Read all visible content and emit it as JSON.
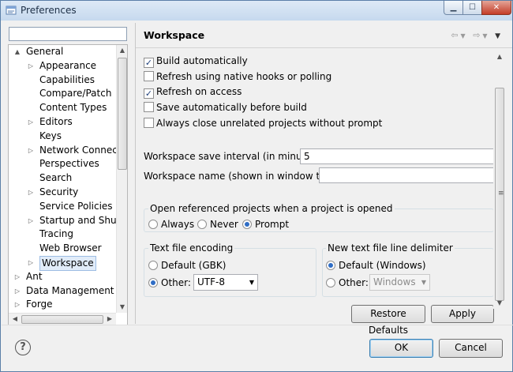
{
  "window": {
    "title": "Preferences"
  },
  "filter": {
    "value": ""
  },
  "tree": {
    "items": [
      {
        "label": "General",
        "level": 0,
        "arrow": "▲"
      },
      {
        "label": "Appearance",
        "level": 1,
        "arrow": "▷"
      },
      {
        "label": "Capabilities",
        "level": 1,
        "arrow": ""
      },
      {
        "label": "Compare/Patch",
        "level": 1,
        "arrow": ""
      },
      {
        "label": "Content Types",
        "level": 1,
        "arrow": ""
      },
      {
        "label": "Editors",
        "level": 1,
        "arrow": "▷"
      },
      {
        "label": "Keys",
        "level": 1,
        "arrow": ""
      },
      {
        "label": "Network Connectio",
        "level": 1,
        "arrow": "▷"
      },
      {
        "label": "Perspectives",
        "level": 1,
        "arrow": ""
      },
      {
        "label": "Search",
        "level": 1,
        "arrow": ""
      },
      {
        "label": "Security",
        "level": 1,
        "arrow": "▷"
      },
      {
        "label": "Service Policies",
        "level": 1,
        "arrow": ""
      },
      {
        "label": "Startup and Shutd",
        "level": 1,
        "arrow": "▷"
      },
      {
        "label": "Tracing",
        "level": 1,
        "arrow": ""
      },
      {
        "label": "Web Browser",
        "level": 1,
        "arrow": ""
      },
      {
        "label": "Workspace",
        "level": 1,
        "arrow": "▷",
        "selected": true
      },
      {
        "label": "Ant",
        "level": 0,
        "arrow": "▷"
      },
      {
        "label": "Data Management",
        "level": 0,
        "arrow": "▷"
      },
      {
        "label": "Forge",
        "level": 0,
        "arrow": "▷"
      }
    ]
  },
  "page": {
    "title": "Workspace",
    "checkboxes": [
      {
        "label": "Build automatically",
        "checked": true
      },
      {
        "label": "Refresh using native hooks or polling",
        "checked": false
      },
      {
        "label": "Refresh on access",
        "checked": true
      },
      {
        "label": "Save automatically before build",
        "checked": false
      },
      {
        "label": "Always close unrelated projects without prompt",
        "checked": false
      }
    ],
    "save_interval_label": "Workspace save interval (in minutes):",
    "save_interval_value": "5",
    "workspace_name_label": "Workspace name (shown in window title):",
    "workspace_name_value": "",
    "open_referenced": {
      "title": "Open referenced projects when a project is opened",
      "options": [
        "Always",
        "Never",
        "Prompt"
      ],
      "selected": "Prompt"
    },
    "encoding": {
      "title": "Text file encoding",
      "default_label": "Default (GBK)",
      "other_label": "Other:",
      "other_value": "UTF-8",
      "selected": "Other"
    },
    "line_delimiter": {
      "title": "New text file line delimiter",
      "default_label": "Default (Windows)",
      "other_label": "Other:",
      "other_value": "Windows",
      "selected": "Default"
    },
    "restore_defaults_label": "Restore Defaults",
    "apply_label": "Apply"
  },
  "footer": {
    "help_symbol": "?",
    "ok_label": "OK",
    "cancel_label": "Cancel"
  },
  "colors": {
    "title_bar": "#c6d9ee",
    "close_button": "#c43c27",
    "selection": "#e1ecf9",
    "radio_dot": "#2f6dc5"
  }
}
